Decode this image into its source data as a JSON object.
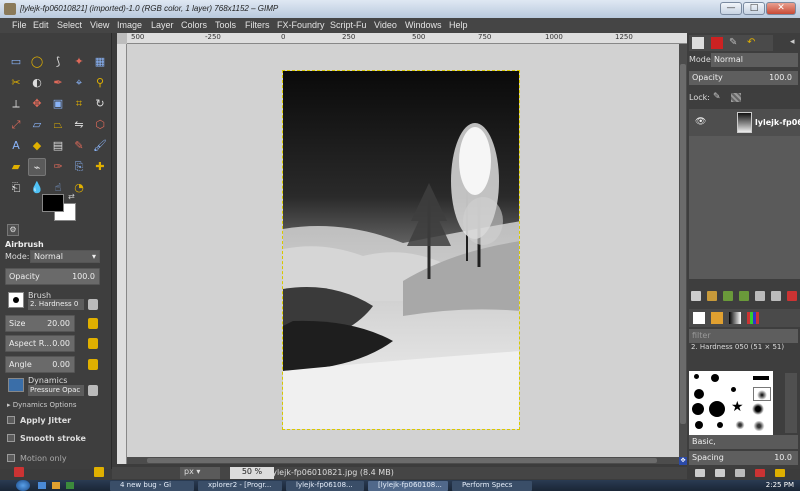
{
  "window": {
    "title": "[lylejk-fp06010821] (imported)-1.0 (RGB color, 1 layer) 768x1152 – GIMP",
    "controls": [
      "—",
      "□",
      "✕"
    ]
  },
  "menu": [
    "File",
    "Edit",
    "Select",
    "View",
    "Image",
    "Layer",
    "Colors",
    "Tools",
    "Filters",
    "FX-Foundry",
    "Script-Fu",
    "Video",
    "Windows",
    "Help"
  ],
  "ruler": {
    "h_ticks": [
      "500",
      "-250",
      "0",
      "250",
      "500",
      "750",
      "1000",
      "1250"
    ]
  },
  "toolbox": {
    "tools": [
      {
        "name": "rect-select-icon",
        "glyph": "▭"
      },
      {
        "name": "ellipse-select-icon",
        "glyph": "◯"
      },
      {
        "name": "free-select-icon",
        "glyph": "⟆"
      },
      {
        "name": "fuzzy-select-icon",
        "glyph": "✦"
      },
      {
        "name": "select-by-color-icon",
        "glyph": "▦"
      },
      {
        "name": "scissors-icon",
        "glyph": "✂"
      },
      {
        "name": "foreground-select-icon",
        "glyph": "◐"
      },
      {
        "name": "paths-icon",
        "glyph": "✒"
      },
      {
        "name": "color-picker-icon",
        "glyph": "⌖"
      },
      {
        "name": "zoom-icon",
        "glyph": "⚲"
      },
      {
        "name": "measure-icon",
        "glyph": "⟂"
      },
      {
        "name": "move-icon",
        "glyph": "✥"
      },
      {
        "name": "align-icon",
        "glyph": "▣"
      },
      {
        "name": "crop-icon",
        "glyph": "⌗"
      },
      {
        "name": "rotate-icon",
        "glyph": "↻"
      },
      {
        "name": "scale-icon",
        "glyph": "⤢"
      },
      {
        "name": "shear-icon",
        "glyph": "▱"
      },
      {
        "name": "perspective-icon",
        "glyph": "⏢"
      },
      {
        "name": "flip-icon",
        "glyph": "⇋"
      },
      {
        "name": "cage-icon",
        "glyph": "⬡"
      },
      {
        "name": "text-icon",
        "glyph": "A"
      },
      {
        "name": "bucket-fill-icon",
        "glyph": "◆"
      },
      {
        "name": "blend-icon",
        "glyph": "▤"
      },
      {
        "name": "pencil-icon",
        "glyph": "✎"
      },
      {
        "name": "paintbrush-icon",
        "glyph": "🖌"
      },
      {
        "name": "eraser-icon",
        "glyph": "▰"
      },
      {
        "name": "airbrush-icon",
        "glyph": "⌁"
      },
      {
        "name": "ink-icon",
        "glyph": "✑"
      },
      {
        "name": "clone-icon",
        "glyph": "⎘"
      },
      {
        "name": "heal-icon",
        "glyph": "✚"
      },
      {
        "name": "perspective-clone-icon",
        "glyph": "⎗"
      },
      {
        "name": "blur-icon",
        "glyph": "💧"
      },
      {
        "name": "smudge-icon",
        "glyph": "☝"
      },
      {
        "name": "dodge-burn-icon",
        "glyph": "◔"
      }
    ],
    "active_tool": "airbrush-icon",
    "fg_color": "#000000",
    "bg_color": "#ffffff"
  },
  "tool_options": {
    "title": "Airbrush",
    "mode_label": "Mode:",
    "mode_value": "Normal",
    "opacity_label": "Opacity",
    "opacity_value": "100.0",
    "brush_label": "Brush",
    "brush_value": "2. Hardness 0",
    "size_label": "Size",
    "size_value": "20.00",
    "aspect_label": "Aspect R...",
    "aspect_value": "0.00",
    "angle_label": "Angle",
    "angle_value": "0.00",
    "dynamics_label": "Dynamics",
    "dynamics_value": "Pressure Opac",
    "dynamics_options": "▸ Dynamics Options",
    "apply_jitter": "Apply Jitter",
    "smooth_stroke": "Smooth stroke",
    "motion_only": "Motion only"
  },
  "status": {
    "units": "px",
    "zoom": "50 %",
    "message": "lylejk-fp06010821.jpg (8.4 MB)"
  },
  "layers": {
    "mode_label": "Mode",
    "mode_value": "Normal",
    "opacity_label": "Opacity",
    "opacity_value": "100.0",
    "lock_label": "Lock:",
    "layer_name": "lylejk-fp060"
  },
  "brushes": {
    "filter_placeholder": "filter",
    "selected": "2. Hardness 050 (51 × 51)",
    "tag_value": "Basic,",
    "spacing_label": "Spacing",
    "spacing_value": "10.0"
  },
  "taskbar": {
    "tasks": [
      "4 new bug - Gi",
      "xplorer2 - [Progr...",
      "lylejk-fp06108...",
      "[lylejk-fp060108...",
      "Perform Specs"
    ],
    "clock": "2:25 PM"
  },
  "colors": {
    "chrome": "#3e3e3e",
    "canvas_bg": "#d2d2d2",
    "accent": "#e0b000"
  }
}
